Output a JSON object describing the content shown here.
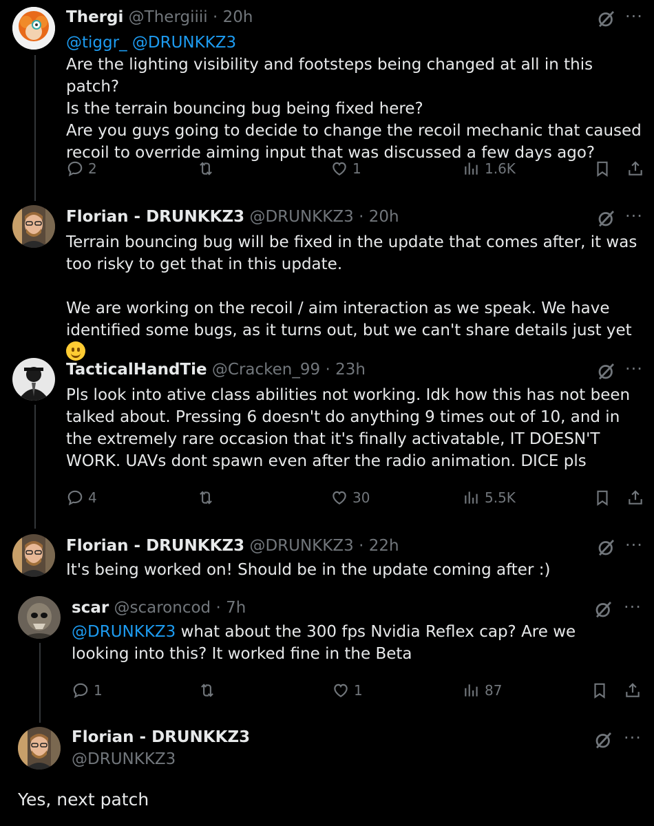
{
  "colors": {
    "background": "#000000",
    "text": "#e7e9ea",
    "muted": "#71767b",
    "link": "#1d9bf0"
  },
  "tweets": [
    {
      "name": "Thergi",
      "handle": "@Thergiiii",
      "sep": "·",
      "time": "20h",
      "mentions": "@tiggr_ @DRUNKKZ3",
      "lines": [
        "Are the lighting visibility and footsteps being changed at all in this patch?",
        "Is the terrain bouncing bug being fixed here?",
        "Are you guys going to decide to change the recoil mechanic that caused recoil to override aiming input that was discussed a few days ago?"
      ],
      "replies": "2",
      "likes": "1",
      "views": "1.6K"
    },
    {
      "name": "Florian - DRUNKKZ3",
      "handle": "@DRUNKKZ3",
      "sep": "·",
      "time": "20h",
      "p1": "Terrain bouncing bug will be fixed in the update that comes after, it was too risky to get that in this update.",
      "p2": "We are working on the recoil / aim interaction as we speak. We have identified some bugs, as it turns out, but we can't share details just yet",
      "emoji": "slightly-smiling-face-emoji"
    },
    {
      "name": "TacticalHandTie",
      "handle": "@Cracken_99",
      "sep": "·",
      "time": "23h",
      "text": "Pls look into ative class abilities not working. Idk how this has not been talked about. Pressing 6 doesn't do anything 9 times out of 10, and in the extremely rare occasion that it's finally activatable, IT DOESN'T WORK. UAVs dont spawn even after the radio animation. DICE pls",
      "replies": "4",
      "likes": "30",
      "views": "5.5K"
    },
    {
      "name": "Florian - DRUNKKZ3",
      "handle": "@DRUNKKZ3",
      "sep": "·",
      "time": "22h",
      "text": "It's being worked on! Should be in the update coming after :)"
    },
    {
      "name": "scar",
      "handle": "@scaroncod",
      "sep": "·",
      "time": "7h",
      "mention": "@DRUNKKZ3",
      "text": " what about the 300 fps Nvidia Reflex cap? Are we looking into this? It worked fine in the Beta",
      "replies": "1",
      "likes": "1",
      "views": "87"
    },
    {
      "name": "Florian - DRUNKKZ3",
      "handle": "@DRUNKKZ3",
      "text": "Yes, next patch"
    }
  ],
  "icons": {
    "grok": "grok-icon",
    "more": "more-icon",
    "reply": "reply-icon",
    "retweet": "retweet-icon",
    "like": "like-icon",
    "views": "views-icon",
    "bookmark": "bookmark-icon",
    "share": "share-icon"
  },
  "more_glyph": "···"
}
